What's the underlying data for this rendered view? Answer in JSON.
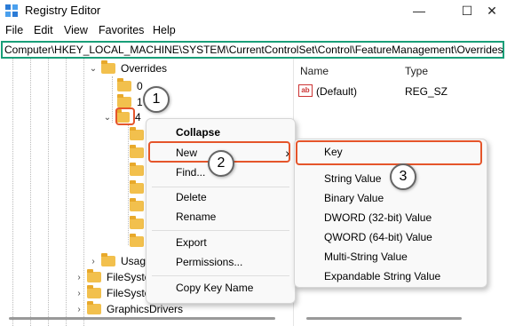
{
  "window": {
    "title": "Registry Editor",
    "minimize": "—",
    "maximize": "☐",
    "close": "✕"
  },
  "menu": [
    "File",
    "Edit",
    "View",
    "Favorites",
    "Help"
  ],
  "address": "Computer\\HKEY_LOCAL_MACHINE\\SYSTEM\\CurrentControlSet\\Control\\FeatureManagement\\Overrides\\4",
  "tree": {
    "overrides": "Overrides",
    "child0": "0",
    "child_partial": "1",
    "child4": "4",
    "usage": "Usag",
    "filesys1": "FileSyste",
    "filesys2": "FileSyste",
    "graphics": "GraphicsDrivers"
  },
  "values": {
    "col_name": "Name",
    "col_type": "Type",
    "rows": [
      {
        "name": "(Default)",
        "type": "REG_SZ",
        "icon": "ab"
      }
    ]
  },
  "context_menu": {
    "items": [
      "Collapse",
      "New",
      "Find...",
      "Delete",
      "Rename",
      "Export",
      "Permissions...",
      "Copy Key Name"
    ],
    "submenu_arrow": "›"
  },
  "submenu": {
    "items": [
      "Key",
      "String Value",
      "Binary Value",
      "DWORD (32-bit) Value",
      "QWORD (64-bit) Value",
      "Multi-String Value",
      "Expandable String Value"
    ]
  },
  "badges": [
    "1",
    "2",
    "3"
  ],
  "colors": {
    "highlight": "#e5552b",
    "address_border": "#1a9e78",
    "folder": "#f2c04d"
  }
}
